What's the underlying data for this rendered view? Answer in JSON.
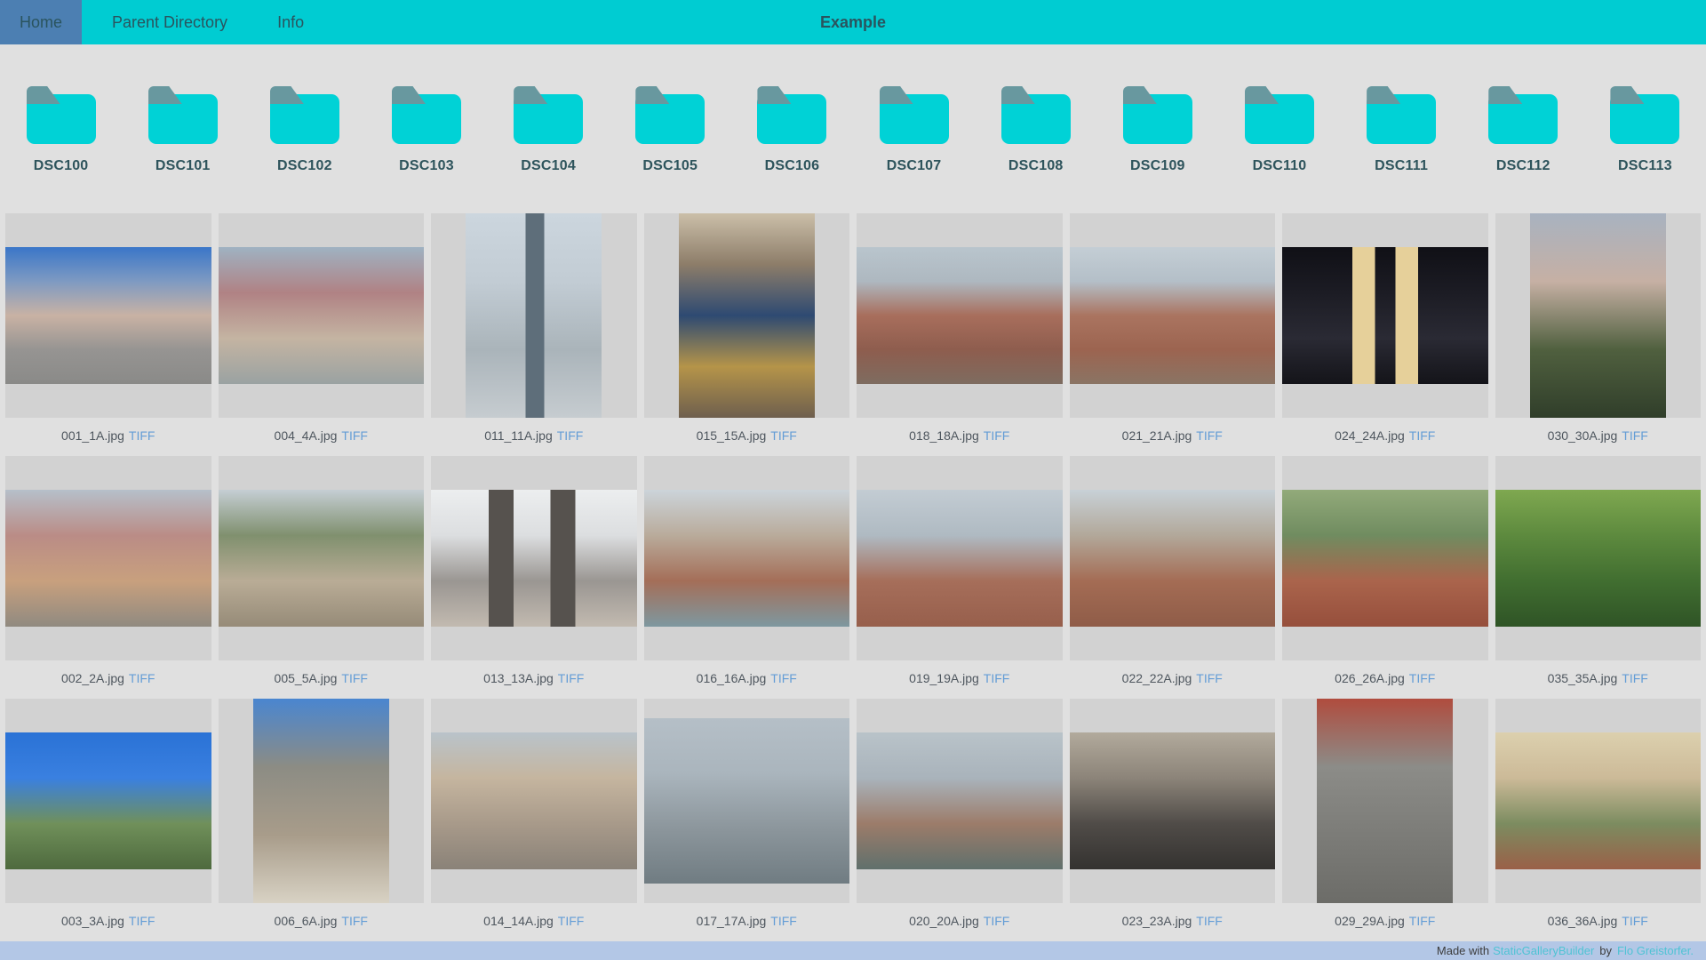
{
  "navbar": {
    "title": "Example",
    "items": [
      {
        "label": "Home",
        "active": true
      },
      {
        "label": "Parent Directory",
        "active": false
      },
      {
        "label": "Info",
        "active": false
      }
    ]
  },
  "folders": [
    "DSC100",
    "DSC101",
    "DSC102",
    "DSC103",
    "DSC104",
    "DSC105",
    "DSC106",
    "DSC107",
    "DSC108",
    "DSC109",
    "DSC110",
    "DSC111",
    "DSC112",
    "DSC113"
  ],
  "gallery": {
    "link_label": "TIFF",
    "images": [
      {
        "file": "001_1A.jpg",
        "ar": "3/2",
        "bands": [
          "#3a76c8",
          "#7e9ac2",
          "#c9b2a4",
          "#969492",
          "#8a8a88"
        ]
      },
      {
        "file": "004_4A.jpg",
        "ar": "3/2",
        "bands": [
          "#9fb2c2",
          "#b08284",
          "#c4b4a2",
          "#9aa2a2"
        ]
      },
      {
        "file": "011_11A.jpg",
        "ar": "2/3",
        "bands": [
          "#ccd6de",
          "#c2ccd4",
          "#aab4ba",
          "#c6ccd0"
        ],
        "bars": [
          [
            44,
            58,
            "#5e6e7a"
          ]
        ]
      },
      {
        "file": "015_15A.jpg",
        "ar": "2/3",
        "bands": [
          "#cbbfa9",
          "#8d7d69",
          "#2e4a72",
          "#b59449",
          "#6e5f4e"
        ]
      },
      {
        "file": "018_18A.jpg",
        "ar": "3/2",
        "bands": [
          "#b9c5cd",
          "#aeb8c0",
          "#a86e5c",
          "#8e5d4e",
          "#7e6c60"
        ]
      },
      {
        "file": "021_21A.jpg",
        "ar": "3/2",
        "bands": [
          "#c4ced5",
          "#b4bfc8",
          "#aa7460",
          "#9c6450",
          "#8a7464"
        ]
      },
      {
        "file": "024_24A.jpg",
        "ar": "3/2",
        "bands": [
          "#101016",
          "#1c1c24",
          "#2a2a34",
          "#141419"
        ],
        "bars": [
          [
            34,
            45,
            "#e6d09a"
          ],
          [
            55,
            66,
            "#e6d09a"
          ]
        ]
      },
      {
        "file": "030_30A.jpg",
        "ar": "2/3",
        "bands": [
          "#a8b2c0",
          "#c6b0a4",
          "#50603f",
          "#303e2a"
        ]
      },
      {
        "file": "002_2A.jpg",
        "ar": "3/2",
        "bands": [
          "#b6c0ca",
          "#ba8c86",
          "#c8a07e",
          "#908a80"
        ]
      },
      {
        "file": "005_5A.jpg",
        "ar": "3/2",
        "bands": [
          "#c5ced4",
          "#80906e",
          "#b9ac96",
          "#968b78"
        ]
      },
      {
        "file": "013_13A.jpg",
        "ar": "3/2",
        "bands": [
          "#eceeef",
          "#dcdee0",
          "#9a9692",
          "#c2bab0"
        ],
        "bars": [
          [
            28,
            40,
            "#56524e"
          ],
          [
            58,
            70,
            "#56524e"
          ]
        ]
      },
      {
        "file": "016_16A.jpg",
        "ar": "3/2",
        "bands": [
          "#ccd4da",
          "#b9ab9b",
          "#a46e58",
          "#7e98a0"
        ]
      },
      {
        "file": "019_19A.jpg",
        "ar": "3/2",
        "bands": [
          "#c3ccd3",
          "#afbac2",
          "#a66e5a",
          "#975f4c"
        ]
      },
      {
        "file": "022_22A.jpg",
        "ar": "3/2",
        "bands": [
          "#c8d1d7",
          "#b2a89a",
          "#a46c54",
          "#8f5c48"
        ]
      },
      {
        "file": "026_26A.jpg",
        "ar": "3/2",
        "bands": [
          "#92aa7a",
          "#708c60",
          "#aa644c",
          "#964f3c"
        ]
      },
      {
        "file": "035_35A.jpg",
        "ar": "3/2",
        "bands": [
          "#7fa850",
          "#5d8a3e",
          "#416e30",
          "#2f5426"
        ]
      },
      {
        "file": "003_3A.jpg",
        "ar": "3/2",
        "bands": [
          "#2a72d6",
          "#3a80e0",
          "#70905a",
          "#4e6a3e"
        ]
      },
      {
        "file": "006_6A.jpg",
        "ar": "2/3",
        "bands": [
          "#4a86d0",
          "#8c8c84",
          "#a89c8a",
          "#d8d2c4"
        ]
      },
      {
        "file": "014_14A.jpg",
        "ar": "3/2",
        "bands": [
          "#b9c3ca",
          "#c5b59f",
          "#a89a8a",
          "#8a8278"
        ]
      },
      {
        "file": "017_17A.jpg",
        "ar": "5/4",
        "bands": [
          "#b5bfc7",
          "#aab5bd",
          "#8c969c",
          "#707c82"
        ]
      },
      {
        "file": "020_20A.jpg",
        "ar": "3/2",
        "bands": [
          "#b9c3c9",
          "#a9b3bb",
          "#9c7c6a",
          "#60706c"
        ]
      },
      {
        "file": "023_23A.jpg",
        "ar": "3/2",
        "bands": [
          "#b2aa9c",
          "#8c8479",
          "#504c48",
          "#343230"
        ]
      },
      {
        "file": "029_29A.jpg",
        "ar": "2/3",
        "bands": [
          "#b04c3e",
          "#8c8c88",
          "#7c7c78",
          "#6c6c68"
        ]
      },
      {
        "file": "036_36A.jpg",
        "ar": "3/2",
        "bands": [
          "#dcd0ae",
          "#ccba98",
          "#7c8c60",
          "#9a6048"
        ]
      }
    ]
  },
  "footer": {
    "prefix": "Made with",
    "builder_link": "StaticGalleryBuilder",
    "middle": "by",
    "author_link": "Flo Greistorfer."
  },
  "colors": {
    "navbar_bg": "#00ccd2",
    "active_item_bg": "#4c7fb2",
    "nav_text": "#2a545e",
    "page_bg": "#e0e0e0",
    "cell_bg": "#d2d2d2",
    "folder_body": "#00d2d6",
    "folder_tab": "#68989f",
    "caption_link": "#649dd6",
    "footer_bg": "#b3c7e6",
    "footer_link": "#4fc3d4"
  }
}
